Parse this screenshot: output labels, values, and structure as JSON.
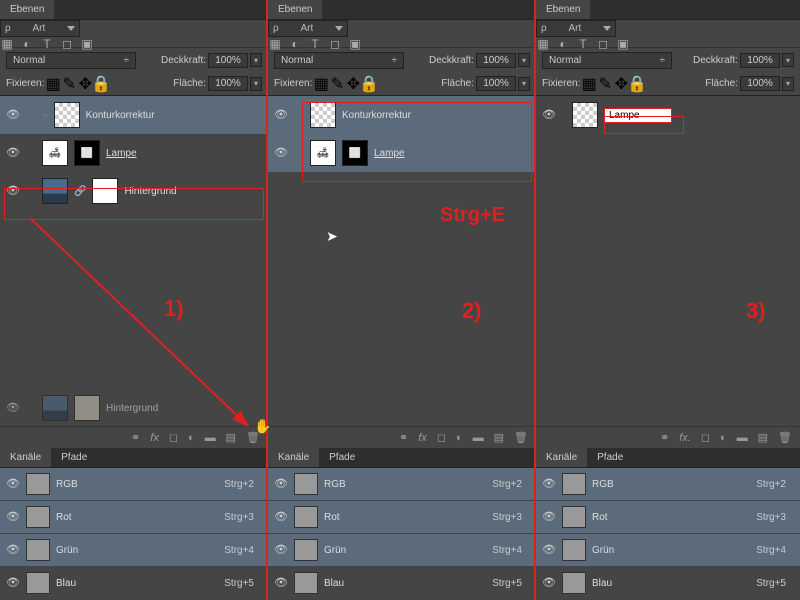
{
  "panel_title": "Ebenen",
  "filter_kind": "Art",
  "blend_mode": "Normal",
  "opacity_label": "Deckkraft:",
  "opacity_value": "100%",
  "lock_label": "Fixieren:",
  "fill_label": "Fläche:",
  "fill_value": "100%",
  "layers1": [
    {
      "name": "Konturkorrektur",
      "sel": true,
      "u": false
    },
    {
      "name": "Lampe",
      "sel": false,
      "u": true
    },
    {
      "name": "Hintergrund",
      "sel": false,
      "u": false
    }
  ],
  "hg_faded": "Hintergrund",
  "layers2": [
    {
      "name": "Konturkorrektur",
      "sel": true,
      "u": false
    },
    {
      "name": "Lampe",
      "sel": true,
      "u": true
    }
  ],
  "rename_value": "Lampe",
  "channels_tab": "Kanäle",
  "paths_tab": "Pfade",
  "channels": [
    {
      "name": "RGB",
      "shortcut": "Strg+2"
    },
    {
      "name": "Rot",
      "shortcut": "Strg+3"
    },
    {
      "name": "Grün",
      "shortcut": "Strg+4"
    },
    {
      "name": "Blau",
      "shortcut": "Strg+5"
    }
  ],
  "anno": {
    "step1": "1)",
    "step2": "2)",
    "step3": "3)",
    "merge": "Strg+E"
  }
}
